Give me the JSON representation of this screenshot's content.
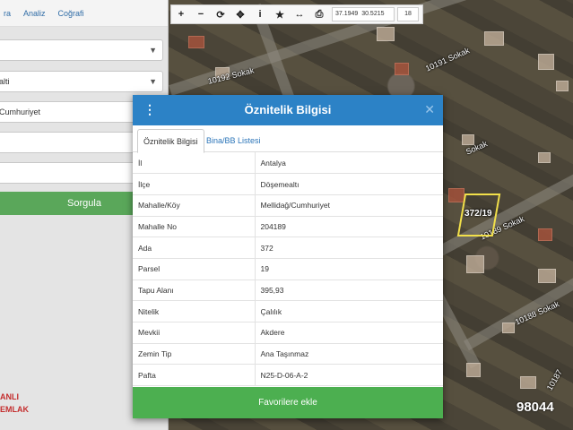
{
  "nav": {
    "items": [
      "Analiz",
      "Coğrafi"
    ],
    "first_partial": "ra"
  },
  "left_panel": {
    "field_values": [
      "",
      "alti",
      "Cumhuriyet",
      "",
      ""
    ],
    "query_button": "Sorgula",
    "logo_lines": [
      "ANLI",
      "EMLAK"
    ]
  },
  "toolbar": {
    "coord_x": "37.1949",
    "coord_y": "30.5215",
    "zoom": "18"
  },
  "map": {
    "street_labels": [
      "10192 Sokak",
      "10191 Sokak",
      "Sokak",
      "10189 Sokak",
      "10188 Sokak",
      "10187"
    ],
    "parcel_label": "372/19"
  },
  "modal": {
    "title": "Öznitelik Bilgisi",
    "tabs": [
      "Öznitelik Bilgisi",
      "Bina/BB Listesi"
    ],
    "rows": [
      {
        "key": "İl",
        "value": "Antalya"
      },
      {
        "key": "İlçe",
        "value": "Döşemealtı"
      },
      {
        "key": "Mahalle/Köy",
        "value": "Mellidağ/Cumhuriyet"
      },
      {
        "key": "Mahalle No",
        "value": "204189"
      },
      {
        "key": "Ada",
        "value": "372"
      },
      {
        "key": "Parsel",
        "value": "19"
      },
      {
        "key": "Tapu Alanı",
        "value": "395,93"
      },
      {
        "key": "Nitelik",
        "value": "Çalılık"
      },
      {
        "key": "Mevkii",
        "value": "Akdere"
      },
      {
        "key": "Zemin Tip",
        "value": "Ana Taşınmaz"
      },
      {
        "key": "Pafta",
        "value": "N25-D-06-A-2"
      }
    ],
    "favorite_button": "Favorilere ekle"
  },
  "listing_id": "98044"
}
